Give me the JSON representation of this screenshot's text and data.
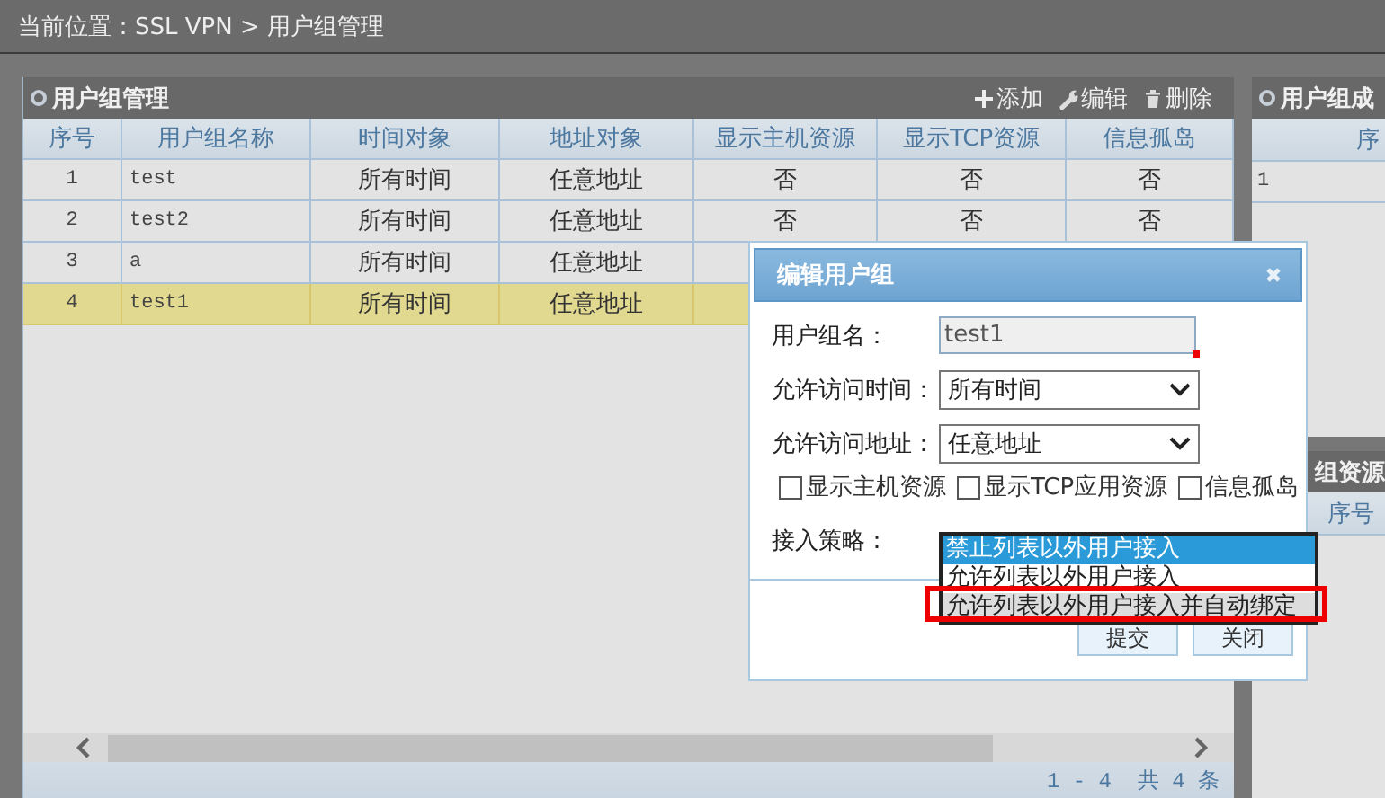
{
  "breadcrumb": "当前位置：SSL VPN > 用户组管理",
  "main_panel": {
    "title": "用户组管理",
    "toolbar": [
      {
        "kind": "add",
        "label": "添加"
      },
      {
        "kind": "edit",
        "label": "编辑"
      },
      {
        "kind": "delete",
        "label": "删除"
      }
    ],
    "table": {
      "columns": [
        "序号",
        "用户组名称",
        "时间对象",
        "地址对象",
        "显示主机资源",
        "显示TCP资源",
        "信息孤岛"
      ],
      "rows": [
        {
          "cells": [
            "1",
            "test",
            "所有时间",
            "任意地址",
            "否",
            "否",
            "否"
          ],
          "selected": false
        },
        {
          "cells": [
            "2",
            "test2",
            "所有时间",
            "任意地址",
            "否",
            "否",
            "否"
          ],
          "selected": false
        },
        {
          "cells": [
            "3",
            "a",
            "所有时间",
            "任意地址"
          ],
          "selected": false
        },
        {
          "cells": [
            "4",
            "test1",
            "所有时间",
            "任意地址"
          ],
          "selected": true
        }
      ]
    },
    "pagination": "1 - 4  共 4 条"
  },
  "members_panel": {
    "title": "用户组成",
    "columns": [
      "序"
    ],
    "rows": [
      [
        "1"
      ]
    ]
  },
  "resources_panel": {
    "title": "组资源",
    "columns": [
      "序号"
    ]
  },
  "dialog": {
    "title": "编辑用户组",
    "fields": [
      {
        "kind": "text",
        "label": "用户组名：",
        "value": "test1",
        "disabled": true
      },
      {
        "kind": "select",
        "label": "允许访问时间：",
        "value": "所有时间"
      },
      {
        "kind": "select",
        "label": "允许访问地址：",
        "value": "任意地址"
      }
    ],
    "checkboxes": [
      {
        "label": "显示主机资源",
        "checked": false
      },
      {
        "label": "显示TCP应用资源",
        "checked": false
      },
      {
        "label": "信息孤岛",
        "checked": false
      }
    ],
    "policy": {
      "label": "接入策略：",
      "options": [
        {
          "label": "禁止列表以外用户接入",
          "selected": true,
          "hovered": false,
          "highlighted": false
        },
        {
          "label": "允许列表以外用户接入",
          "selected": false,
          "hovered": false,
          "highlighted": false
        },
        {
          "label": "允许列表以外用户接入并自动绑定",
          "selected": false,
          "hovered": true,
          "highlighted": true
        }
      ]
    },
    "buttons": [
      "提交",
      "关闭"
    ]
  }
}
